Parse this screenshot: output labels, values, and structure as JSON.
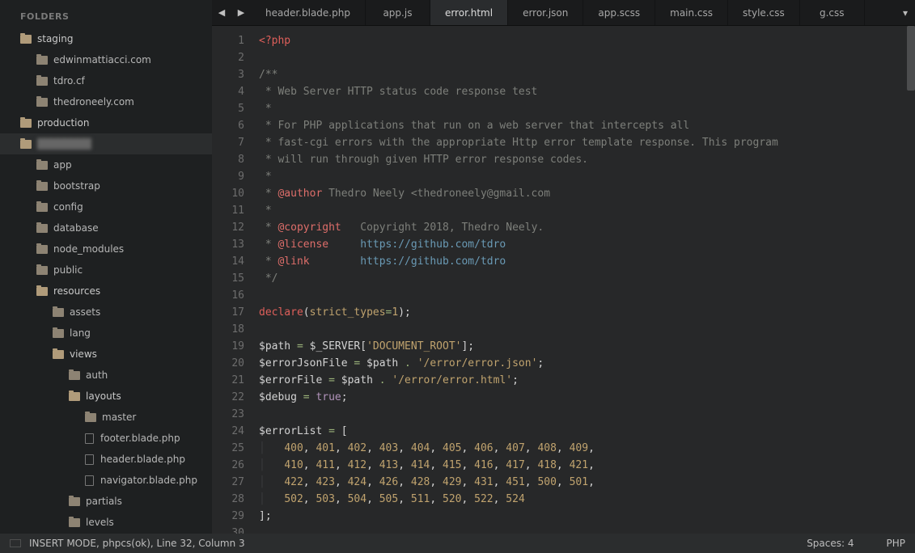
{
  "sidebar": {
    "header": "FOLDERS",
    "tree": [
      {
        "type": "folder",
        "label": "staging",
        "depth": 0,
        "open": true
      },
      {
        "type": "folder",
        "label": "edwinmattiacci.com",
        "depth": 1
      },
      {
        "type": "folder",
        "label": "tdro.cf",
        "depth": 1
      },
      {
        "type": "folder",
        "label": "thedroneely.com",
        "depth": 1
      },
      {
        "type": "folder",
        "label": "production",
        "depth": 0,
        "open": true
      },
      {
        "type": "folder",
        "label": "",
        "depth": 0,
        "open": true,
        "selected": true,
        "blur": true
      },
      {
        "type": "folder",
        "label": "app",
        "depth": 1
      },
      {
        "type": "folder",
        "label": "bootstrap",
        "depth": 1
      },
      {
        "type": "folder",
        "label": "config",
        "depth": 1
      },
      {
        "type": "folder",
        "label": "database",
        "depth": 1
      },
      {
        "type": "folder",
        "label": "node_modules",
        "depth": 1
      },
      {
        "type": "folder",
        "label": "public",
        "depth": 1
      },
      {
        "type": "folder",
        "label": "resources",
        "depth": 1,
        "open": true
      },
      {
        "type": "folder",
        "label": "assets",
        "depth": 2
      },
      {
        "type": "folder",
        "label": "lang",
        "depth": 2
      },
      {
        "type": "folder",
        "label": "views",
        "depth": 2,
        "open": true
      },
      {
        "type": "folder",
        "label": "auth",
        "depth": 3
      },
      {
        "type": "folder",
        "label": "layouts",
        "depth": 3,
        "open": true
      },
      {
        "type": "folder",
        "label": "master",
        "depth": 4
      },
      {
        "type": "file",
        "label": "footer.blade.php",
        "depth": 4
      },
      {
        "type": "file",
        "label": "header.blade.php",
        "depth": 4
      },
      {
        "type": "file",
        "label": "navigator.blade.php",
        "depth": 4
      },
      {
        "type": "folder",
        "label": "partials",
        "depth": 3
      },
      {
        "type": "folder",
        "label": "levels",
        "depth": 3
      }
    ]
  },
  "tabs": {
    "prev": "◀",
    "next": "▶",
    "overflow": "▾",
    "items": [
      {
        "label": "header.blade.php"
      },
      {
        "label": "app.js"
      },
      {
        "label": "error.html",
        "active": true
      },
      {
        "label": "error.json"
      },
      {
        "label": "app.scss"
      },
      {
        "label": "main.css"
      },
      {
        "label": "style.css"
      },
      {
        "label": "g.css"
      }
    ]
  },
  "editor": {
    "lines": [
      {
        "n": 1,
        "t": [
          [
            "<?php",
            "c-key"
          ]
        ]
      },
      {
        "n": 2,
        "t": [
          [
            "",
            ""
          ]
        ]
      },
      {
        "n": 3,
        "t": [
          [
            "/**",
            "c-comment"
          ]
        ]
      },
      {
        "n": 4,
        "t": [
          [
            " * Web Server HTTP status code response test",
            "c-comment"
          ]
        ]
      },
      {
        "n": 5,
        "t": [
          [
            " *",
            "c-comment"
          ]
        ]
      },
      {
        "n": 6,
        "t": [
          [
            " * For PHP applications that run on a web server that intercepts all",
            "c-comment"
          ]
        ]
      },
      {
        "n": 7,
        "t": [
          [
            " * fast-cgi errors with the appropriate Http error template response. This program",
            "c-comment"
          ]
        ]
      },
      {
        "n": 8,
        "t": [
          [
            " * will run through given HTTP error response codes.",
            "c-comment"
          ]
        ]
      },
      {
        "n": 9,
        "t": [
          [
            " *",
            "c-comment"
          ]
        ]
      },
      {
        "n": 10,
        "t": [
          [
            " * ",
            "c-comment"
          ],
          [
            "@author",
            "c-tag"
          ],
          [
            " Thedro Neely <thedroneely@gmail.com",
            "c-comment"
          ]
        ]
      },
      {
        "n": 11,
        "t": [
          [
            " *",
            "c-comment"
          ]
        ]
      },
      {
        "n": 12,
        "t": [
          [
            " * ",
            "c-comment"
          ],
          [
            "@copyright",
            "c-tag"
          ],
          [
            "   Copyright 2018, Thedro Neely.",
            "c-comment"
          ]
        ]
      },
      {
        "n": 13,
        "t": [
          [
            " * ",
            "c-comment"
          ],
          [
            "@license",
            "c-tag"
          ],
          [
            "     ",
            "c-comment"
          ],
          [
            "https://github.com/tdro",
            "c-link"
          ]
        ]
      },
      {
        "n": 14,
        "t": [
          [
            " * ",
            "c-comment"
          ],
          [
            "@link",
            "c-tag"
          ],
          [
            "        ",
            "c-comment"
          ],
          [
            "https://github.com/tdro",
            "c-link"
          ]
        ]
      },
      {
        "n": 15,
        "t": [
          [
            " */",
            "c-comment"
          ]
        ]
      },
      {
        "n": 16,
        "t": [
          [
            "",
            ""
          ]
        ]
      },
      {
        "n": 17,
        "t": [
          [
            "declare",
            "c-key"
          ],
          [
            "(",
            "c-var"
          ],
          [
            "strict_types",
            "c-ident"
          ],
          [
            "=",
            "c-op"
          ],
          [
            "1",
            "c-num"
          ],
          [
            ")",
            "c-var"
          ],
          [
            ";",
            "c-var"
          ]
        ]
      },
      {
        "n": 18,
        "t": [
          [
            "",
            ""
          ]
        ]
      },
      {
        "n": 19,
        "t": [
          [
            "$path",
            "c-var"
          ],
          [
            " ",
            ""
          ],
          [
            "=",
            "c-op"
          ],
          [
            " $_SERVER[",
            "c-var"
          ],
          [
            "'DOCUMENT_ROOT'",
            "c-str"
          ],
          [
            "];",
            "c-var"
          ]
        ]
      },
      {
        "n": 20,
        "t": [
          [
            "$errorJsonFile",
            "c-var"
          ],
          [
            " ",
            ""
          ],
          [
            "=",
            "c-op"
          ],
          [
            " $path ",
            "c-var"
          ],
          [
            ".",
            "c-op"
          ],
          [
            " ",
            ""
          ],
          [
            "'/error/error.json'",
            "c-str"
          ],
          [
            ";",
            "c-var"
          ]
        ]
      },
      {
        "n": 21,
        "t": [
          [
            "$errorFile",
            "c-var"
          ],
          [
            " ",
            ""
          ],
          [
            "=",
            "c-op"
          ],
          [
            " $path ",
            "c-var"
          ],
          [
            ".",
            "c-op"
          ],
          [
            " ",
            ""
          ],
          [
            "'/error/error.html'",
            "c-str"
          ],
          [
            ";",
            "c-var"
          ]
        ]
      },
      {
        "n": 22,
        "t": [
          [
            "$debug",
            "c-var"
          ],
          [
            " ",
            ""
          ],
          [
            "=",
            "c-op"
          ],
          [
            " ",
            ""
          ],
          [
            "true",
            "c-bool"
          ],
          [
            ";",
            "c-var"
          ]
        ]
      },
      {
        "n": 23,
        "t": [
          [
            "",
            ""
          ]
        ]
      },
      {
        "n": 24,
        "t": [
          [
            "$errorList",
            "c-var"
          ],
          [
            " ",
            ""
          ],
          [
            "=",
            "c-op"
          ],
          [
            " [",
            "c-var"
          ]
        ]
      },
      {
        "n": 25,
        "t": [
          [
            "│   ",
            "indent-guide"
          ],
          [
            "400",
            "c-num"
          ],
          [
            ", ",
            "c-var"
          ],
          [
            "401",
            "c-num"
          ],
          [
            ", ",
            "c-var"
          ],
          [
            "402",
            "c-num"
          ],
          [
            ", ",
            "c-var"
          ],
          [
            "403",
            "c-num"
          ],
          [
            ", ",
            "c-var"
          ],
          [
            "404",
            "c-num"
          ],
          [
            ", ",
            "c-var"
          ],
          [
            "405",
            "c-num"
          ],
          [
            ", ",
            "c-var"
          ],
          [
            "406",
            "c-num"
          ],
          [
            ", ",
            "c-var"
          ],
          [
            "407",
            "c-num"
          ],
          [
            ", ",
            "c-var"
          ],
          [
            "408",
            "c-num"
          ],
          [
            ", ",
            "c-var"
          ],
          [
            "409",
            "c-num"
          ],
          [
            ",",
            "c-var"
          ]
        ]
      },
      {
        "n": 26,
        "t": [
          [
            "│   ",
            "indent-guide"
          ],
          [
            "410",
            "c-num"
          ],
          [
            ", ",
            "c-var"
          ],
          [
            "411",
            "c-num"
          ],
          [
            ", ",
            "c-var"
          ],
          [
            "412",
            "c-num"
          ],
          [
            ", ",
            "c-var"
          ],
          [
            "413",
            "c-num"
          ],
          [
            ", ",
            "c-var"
          ],
          [
            "414",
            "c-num"
          ],
          [
            ", ",
            "c-var"
          ],
          [
            "415",
            "c-num"
          ],
          [
            ", ",
            "c-var"
          ],
          [
            "416",
            "c-num"
          ],
          [
            ", ",
            "c-var"
          ],
          [
            "417",
            "c-num"
          ],
          [
            ", ",
            "c-var"
          ],
          [
            "418",
            "c-num"
          ],
          [
            ", ",
            "c-var"
          ],
          [
            "421",
            "c-num"
          ],
          [
            ",",
            "c-var"
          ]
        ]
      },
      {
        "n": 27,
        "t": [
          [
            "│   ",
            "indent-guide"
          ],
          [
            "422",
            "c-num"
          ],
          [
            ", ",
            "c-var"
          ],
          [
            "423",
            "c-num"
          ],
          [
            ", ",
            "c-var"
          ],
          [
            "424",
            "c-num"
          ],
          [
            ", ",
            "c-var"
          ],
          [
            "426",
            "c-num"
          ],
          [
            ", ",
            "c-var"
          ],
          [
            "428",
            "c-num"
          ],
          [
            ", ",
            "c-var"
          ],
          [
            "429",
            "c-num"
          ],
          [
            ", ",
            "c-var"
          ],
          [
            "431",
            "c-num"
          ],
          [
            ", ",
            "c-var"
          ],
          [
            "451",
            "c-num"
          ],
          [
            ", ",
            "c-var"
          ],
          [
            "500",
            "c-num"
          ],
          [
            ", ",
            "c-var"
          ],
          [
            "501",
            "c-num"
          ],
          [
            ",",
            "c-var"
          ]
        ]
      },
      {
        "n": 28,
        "t": [
          [
            "│   ",
            "indent-guide"
          ],
          [
            "502",
            "c-num"
          ],
          [
            ", ",
            "c-var"
          ],
          [
            "503",
            "c-num"
          ],
          [
            ", ",
            "c-var"
          ],
          [
            "504",
            "c-num"
          ],
          [
            ", ",
            "c-var"
          ],
          [
            "505",
            "c-num"
          ],
          [
            ", ",
            "c-var"
          ],
          [
            "511",
            "c-num"
          ],
          [
            ", ",
            "c-var"
          ],
          [
            "520",
            "c-num"
          ],
          [
            ", ",
            "c-var"
          ],
          [
            "522",
            "c-num"
          ],
          [
            ", ",
            "c-var"
          ],
          [
            "524",
            "c-num"
          ]
        ]
      },
      {
        "n": 29,
        "t": [
          [
            "];",
            "c-var"
          ]
        ]
      },
      {
        "n": 30,
        "t": [
          [
            "",
            ""
          ]
        ]
      }
    ]
  },
  "status": {
    "left": "INSERT MODE, phpcs(ok), Line 32, Column 3",
    "spaces": "Spaces: 4",
    "lang": "PHP"
  }
}
